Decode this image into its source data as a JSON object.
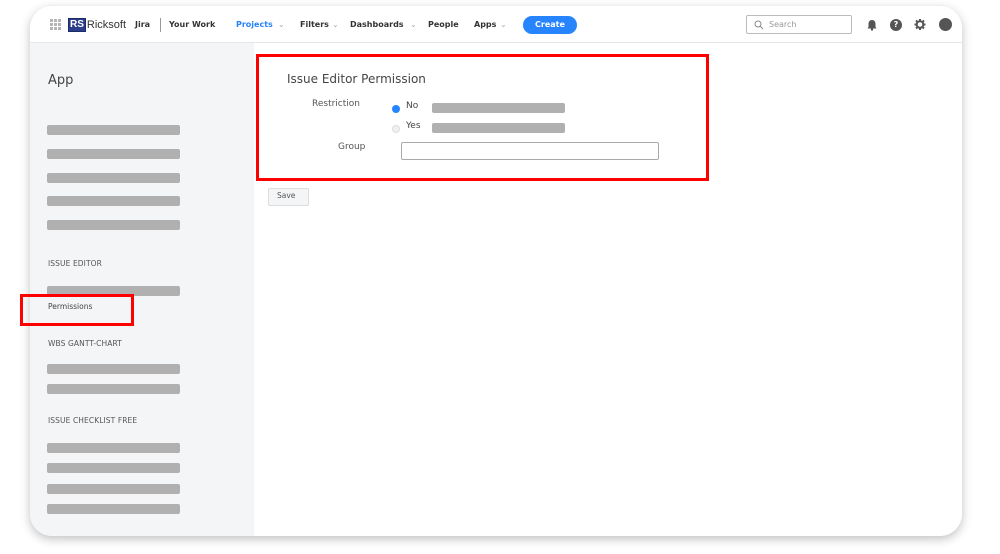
{
  "topnav": {
    "logo_badge": "RS",
    "logo_text": "Ricksoft",
    "product": "Jira",
    "your_work": "Your Work",
    "menus": [
      {
        "label": "Projects",
        "active": true,
        "has_dropdown": true
      },
      {
        "label": "Filters",
        "has_dropdown": true
      },
      {
        "label": "Dashboards",
        "has_dropdown": true
      },
      {
        "label": "People",
        "has_dropdown": false
      },
      {
        "label": "Apps",
        "has_dropdown": true
      }
    ],
    "create_label": "Create",
    "search_placeholder": "Search",
    "icons": [
      "app-grid-icon",
      "search-icon",
      "notification-bell-icon",
      "help-icon",
      "settings-gear-icon",
      "user-avatar"
    ],
    "accent_color": "#2684ff"
  },
  "sidebar": {
    "title": "App",
    "sections": [
      {
        "heading": "ISSUE EDITOR",
        "items": [
          "Permissions"
        ],
        "selected": "Permissions"
      },
      {
        "heading": "WBS GANTT-CHART"
      },
      {
        "heading": "ISSUE CHECKLIST FREE"
      }
    ]
  },
  "form": {
    "title": "Issue Editor Permission",
    "restriction_label": "Restriction",
    "options": [
      {
        "label": "No",
        "selected": true
      },
      {
        "label": "Yes",
        "selected": false
      }
    ],
    "group_label": "Group",
    "group_value": "",
    "save_label": "Save"
  },
  "highlight_color": "#ff0000"
}
